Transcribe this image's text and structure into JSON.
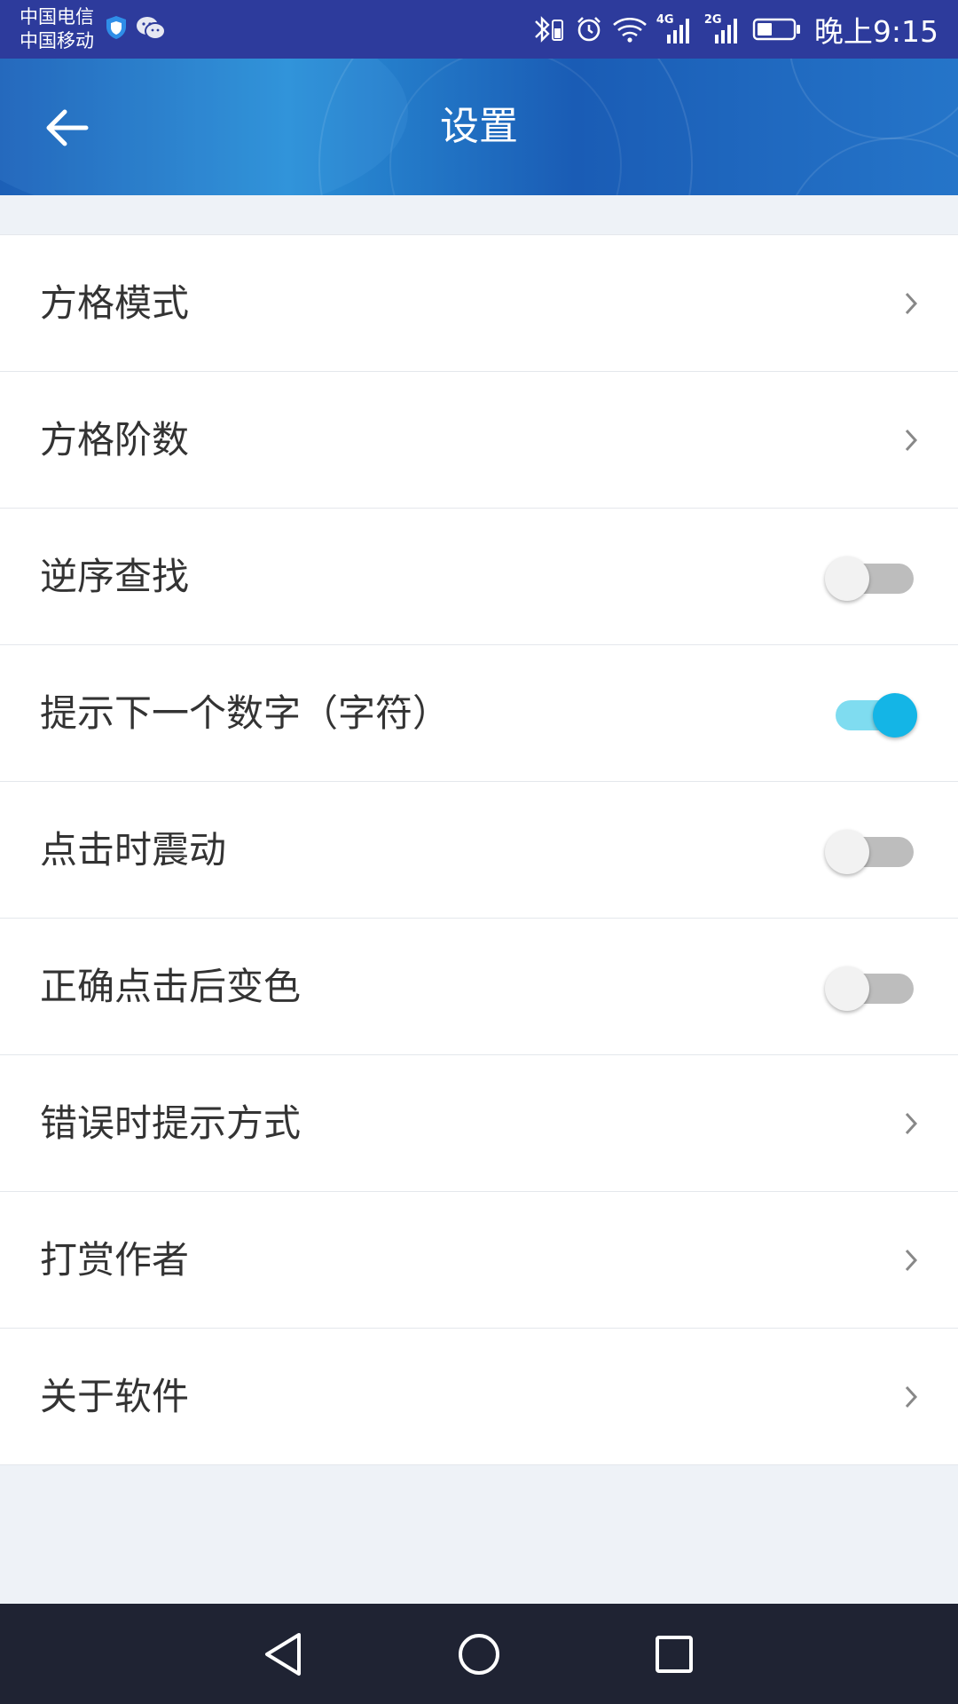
{
  "status_bar": {
    "carrier_1": "中国电信",
    "carrier_2": "中国移动",
    "network_1": "4G",
    "network_2": "2G",
    "time": "晚上9:15",
    "icons": [
      "shield-icon",
      "wechat-icon",
      "bluetooth-icon",
      "alarm-icon",
      "wifi-icon",
      "signal-icon",
      "battery-icon"
    ]
  },
  "header": {
    "title": "设置",
    "back_icon": "arrow-left-icon"
  },
  "settings": {
    "items": [
      {
        "label": "方格模式",
        "control": "chevron"
      },
      {
        "label": "方格阶数",
        "control": "chevron"
      },
      {
        "label": "逆序查找",
        "control": "toggle",
        "on": false
      },
      {
        "label": "提示下一个数字（字符）",
        "control": "toggle",
        "on": true
      },
      {
        "label": "点击时震动",
        "control": "toggle",
        "on": false
      },
      {
        "label": "正确点击后变色",
        "control": "toggle",
        "on": false
      },
      {
        "label": "错误时提示方式",
        "control": "chevron"
      },
      {
        "label": "打赏作者",
        "control": "chevron"
      },
      {
        "label": "关于软件",
        "control": "chevron"
      }
    ]
  },
  "nav_bar": {
    "icons": [
      "nav-back-icon",
      "nav-home-icon",
      "nav-recent-icon"
    ]
  },
  "colors": {
    "status_bar": "#2d3b9c",
    "header_blue": "#1c5fb6",
    "toggle_on": "#14b5e6",
    "toggle_on_track": "#7fdcf0",
    "toggle_off_track": "#bdbdbd",
    "nav_bar": "#1f2333"
  }
}
